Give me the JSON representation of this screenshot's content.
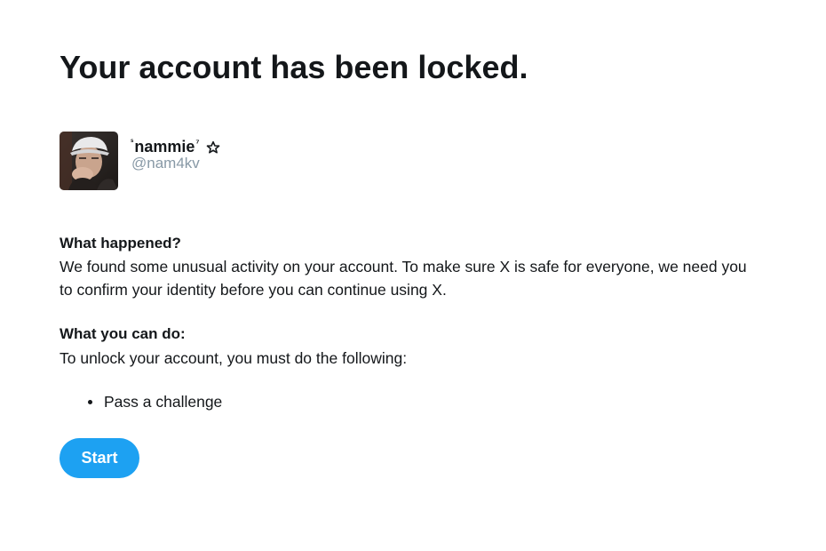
{
  "page": {
    "title": "Your account has been locked."
  },
  "profile": {
    "name_prefix": "ˢ",
    "name": "nammie",
    "name_suffix": "⁷",
    "badge_icon": "star-outline-icon",
    "handle": "@nam4kv"
  },
  "what_happened": {
    "heading": "What happened?",
    "body": "We found some unusual activity on your account. To make sure X is safe for everyone, we need you to confirm your identity before you can continue using X."
  },
  "what_you_can_do": {
    "heading": "What you can do:",
    "body": "To unlock your account, you must do the following:",
    "steps": [
      "Pass a challenge"
    ]
  },
  "actions": {
    "start_label": "Start"
  },
  "colors": {
    "accent": "#1da1f2",
    "text": "#14171a",
    "muted": "#8899a6"
  }
}
